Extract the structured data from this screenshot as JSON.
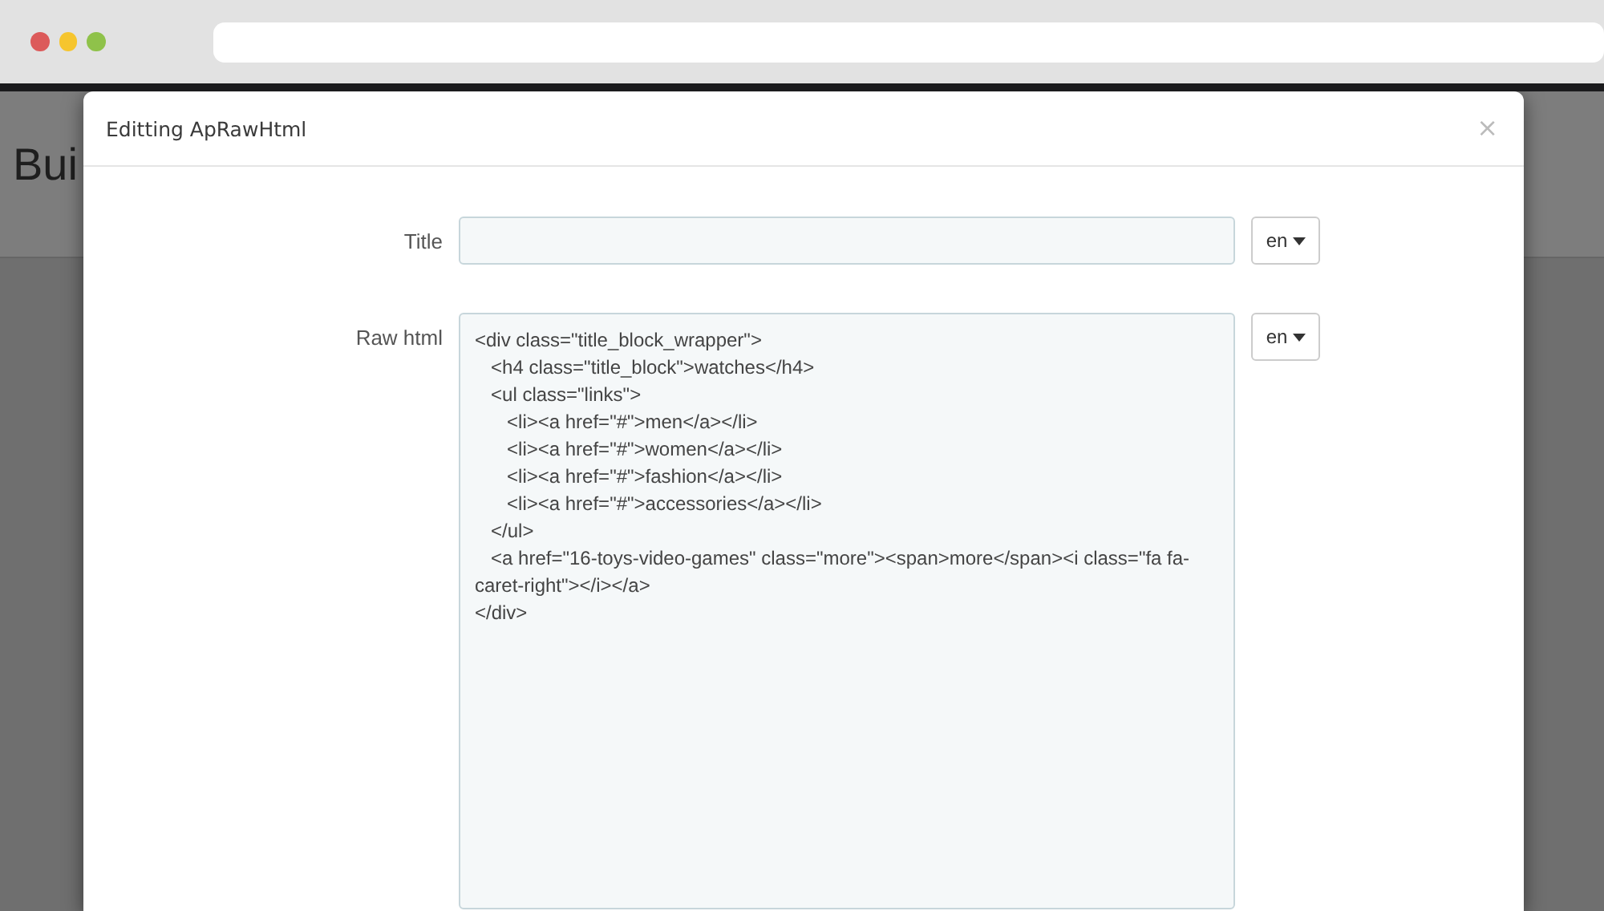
{
  "background_page": {
    "heading": "Bui"
  },
  "modal": {
    "title": "Editting ApRawHtml",
    "close": "×",
    "fields": [
      {
        "kind": "input",
        "label": "Title",
        "language": "en"
      },
      {
        "kind": "textarea",
        "label": "Raw html",
        "value": "<div class=\"title_block_wrapper\">\n   <h4 class=\"title_block\">watches</h4>\n   <ul class=\"links\">\n      <li><a href=\"#\">men</a></li>\n      <li><a href=\"#\">women</a></li>\n      <li><a href=\"#\">fashion</a></li>\n      <li><a href=\"#\">accessories</a></li>\n   </ul>\n   <a href=\"16-toys-video-games\" class=\"more\"><span>more</span><i class=\"fa fa-caret-right\"></i></a>\n</div>",
        "language": "en"
      }
    ]
  }
}
